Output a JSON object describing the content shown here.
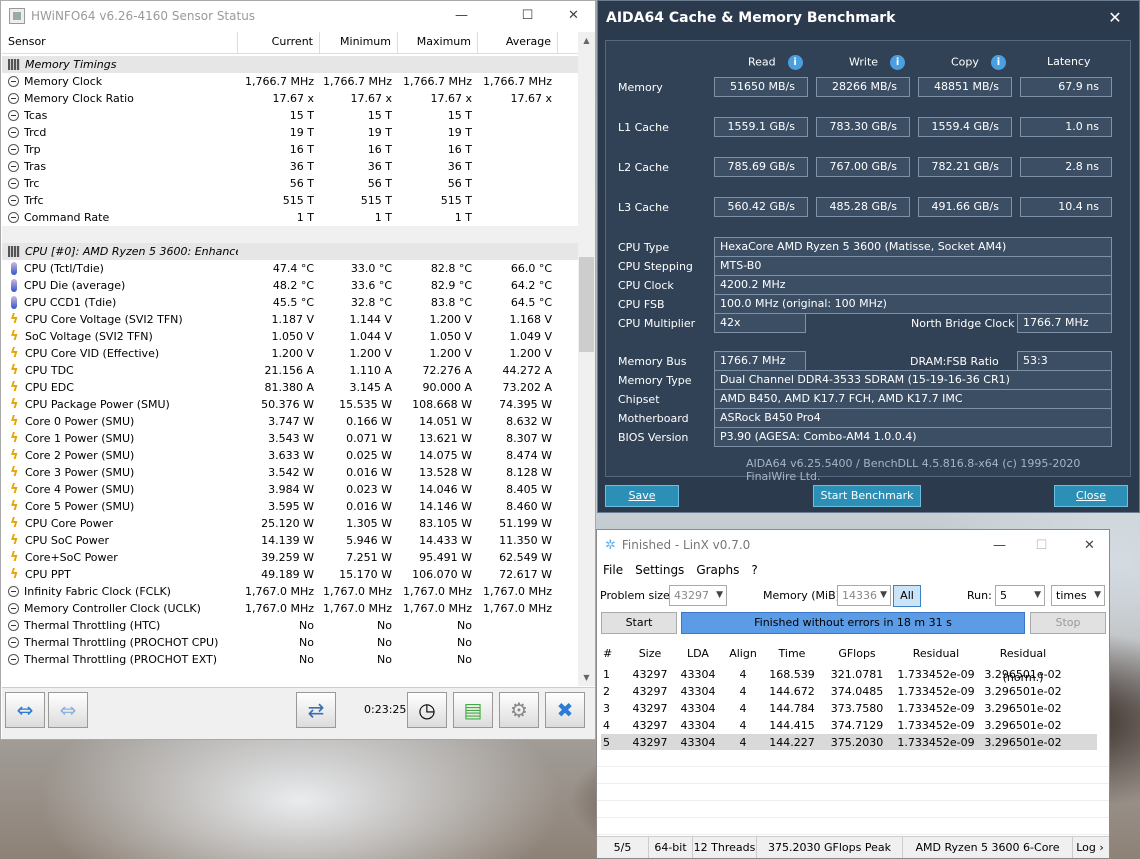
{
  "hwinfo": {
    "title": "HWiNFO64 v6.26-4160 Sensor Status",
    "columns": [
      "Sensor",
      "Current",
      "Minimum",
      "Maximum",
      "Average"
    ],
    "rows": [
      {
        "icon": "group",
        "name": "Memory Timings",
        "cur": "",
        "min": "",
        "max": "",
        "avg": ""
      },
      {
        "icon": "gauge",
        "name": "Memory Clock",
        "cur": "1,766.7 MHz",
        "min": "1,766.7 MHz",
        "max": "1,766.7 MHz",
        "avg": "1,766.7 MHz"
      },
      {
        "icon": "gauge",
        "name": "Memory Clock Ratio",
        "cur": "17.67 x",
        "min": "17.67 x",
        "max": "17.67 x",
        "avg": "17.67 x"
      },
      {
        "icon": "gauge",
        "name": "Tcas",
        "cur": "15 T",
        "min": "15 T",
        "max": "15 T",
        "avg": ""
      },
      {
        "icon": "gauge",
        "name": "Trcd",
        "cur": "19 T",
        "min": "19 T",
        "max": "19 T",
        "avg": ""
      },
      {
        "icon": "gauge",
        "name": "Trp",
        "cur": "16 T",
        "min": "16 T",
        "max": "16 T",
        "avg": ""
      },
      {
        "icon": "gauge",
        "name": "Tras",
        "cur": "36 T",
        "min": "36 T",
        "max": "36 T",
        "avg": ""
      },
      {
        "icon": "gauge",
        "name": "Trc",
        "cur": "56 T",
        "min": "56 T",
        "max": "56 T",
        "avg": ""
      },
      {
        "icon": "gauge",
        "name": "Trfc",
        "cur": "515 T",
        "min": "515 T",
        "max": "515 T",
        "avg": ""
      },
      {
        "icon": "gauge",
        "name": "Command Rate",
        "cur": "1 T",
        "min": "1 T",
        "max": "1 T",
        "avg": ""
      },
      {
        "icon": "blank",
        "name": "",
        "cur": "",
        "min": "",
        "max": "",
        "avg": ""
      },
      {
        "icon": "group",
        "name": "CPU [#0]: AMD Ryzen 5 3600: Enhanced",
        "cur": "",
        "min": "",
        "max": "",
        "avg": ""
      },
      {
        "icon": "temp",
        "name": "CPU (Tctl/Tdie)",
        "cur": "47.4 °C",
        "min": "33.0 °C",
        "max": "82.8 °C",
        "avg": "66.0 °C"
      },
      {
        "icon": "temp",
        "name": "CPU Die (average)",
        "cur": "48.2 °C",
        "min": "33.6 °C",
        "max": "82.9 °C",
        "avg": "64.2 °C"
      },
      {
        "icon": "temp",
        "name": "CPU CCD1 (Tdie)",
        "cur": "45.5 °C",
        "min": "32.8 °C",
        "max": "83.8 °C",
        "avg": "64.5 °C"
      },
      {
        "icon": "bolt",
        "name": "CPU Core Voltage (SVI2 TFN)",
        "cur": "1.187 V",
        "min": "1.144 V",
        "max": "1.200 V",
        "avg": "1.168 V"
      },
      {
        "icon": "bolt",
        "name": "SoC Voltage (SVI2 TFN)",
        "cur": "1.050 V",
        "min": "1.044 V",
        "max": "1.050 V",
        "avg": "1.049 V"
      },
      {
        "icon": "bolt",
        "name": "CPU Core VID (Effective)",
        "cur": "1.200 V",
        "min": "1.200 V",
        "max": "1.200 V",
        "avg": "1.200 V"
      },
      {
        "icon": "bolt",
        "name": "CPU TDC",
        "cur": "21.156 A",
        "min": "1.110 A",
        "max": "72.276 A",
        "avg": "44.272 A"
      },
      {
        "icon": "bolt",
        "name": "CPU EDC",
        "cur": "81.380 A",
        "min": "3.145 A",
        "max": "90.000 A",
        "avg": "73.202 A"
      },
      {
        "icon": "bolt",
        "name": "CPU Package Power (SMU)",
        "cur": "50.376 W",
        "min": "15.535 W",
        "max": "108.668 W",
        "avg": "74.395 W"
      },
      {
        "icon": "bolt",
        "name": "Core 0 Power (SMU)",
        "cur": "3.747 W",
        "min": "0.166 W",
        "max": "14.051 W",
        "avg": "8.632 W"
      },
      {
        "icon": "bolt",
        "name": "Core 1 Power (SMU)",
        "cur": "3.543 W",
        "min": "0.071 W",
        "max": "13.621 W",
        "avg": "8.307 W"
      },
      {
        "icon": "bolt",
        "name": "Core 2 Power (SMU)",
        "cur": "3.633 W",
        "min": "0.025 W",
        "max": "14.075 W",
        "avg": "8.474 W"
      },
      {
        "icon": "bolt",
        "name": "Core 3 Power (SMU)",
        "cur": "3.542 W",
        "min": "0.016 W",
        "max": "13.528 W",
        "avg": "8.128 W"
      },
      {
        "icon": "bolt",
        "name": "Core 4 Power (SMU)",
        "cur": "3.984 W",
        "min": "0.023 W",
        "max": "14.046 W",
        "avg": "8.405 W"
      },
      {
        "icon": "bolt",
        "name": "Core 5 Power (SMU)",
        "cur": "3.595 W",
        "min": "0.016 W",
        "max": "14.146 W",
        "avg": "8.460 W"
      },
      {
        "icon": "bolt",
        "name": "CPU Core Power",
        "cur": "25.120 W",
        "min": "1.305 W",
        "max": "83.105 W",
        "avg": "51.199 W"
      },
      {
        "icon": "bolt",
        "name": "CPU SoC Power",
        "cur": "14.139 W",
        "min": "5.946 W",
        "max": "14.433 W",
        "avg": "11.350 W"
      },
      {
        "icon": "bolt",
        "name": "Core+SoC Power",
        "cur": "39.259 W",
        "min": "7.251 W",
        "max": "95.491 W",
        "avg": "62.549 W"
      },
      {
        "icon": "bolt",
        "name": "CPU PPT",
        "cur": "49.189 W",
        "min": "15.170 W",
        "max": "106.070 W",
        "avg": "72.617 W"
      },
      {
        "icon": "gauge",
        "name": "Infinity Fabric Clock (FCLK)",
        "cur": "1,767.0 MHz",
        "min": "1,767.0 MHz",
        "max": "1,767.0 MHz",
        "avg": "1,767.0 MHz"
      },
      {
        "icon": "gauge",
        "name": "Memory Controller Clock (UCLK)",
        "cur": "1,767.0 MHz",
        "min": "1,767.0 MHz",
        "max": "1,767.0 MHz",
        "avg": "1,767.0 MHz"
      },
      {
        "icon": "gauge",
        "name": "Thermal Throttling (HTC)",
        "cur": "No",
        "min": "No",
        "max": "No",
        "avg": ""
      },
      {
        "icon": "gauge",
        "name": "Thermal Throttling (PROCHOT CPU)",
        "cur": "No",
        "min": "No",
        "max": "No",
        "avg": ""
      },
      {
        "icon": "gauge",
        "name": "Thermal Throttling (PROCHOT EXT)",
        "cur": "No",
        "min": "No",
        "max": "No",
        "avg": ""
      }
    ],
    "timer": "0:23:25"
  },
  "aida": {
    "title": "AIDA64 Cache & Memory Benchmark",
    "cols": [
      "Read",
      "Write",
      "Copy",
      "Latency"
    ],
    "bench": [
      {
        "label": "Memory",
        "read": "51650 MB/s",
        "write": "28266 MB/s",
        "copy": "48851 MB/s",
        "lat": "67.9 ns"
      },
      {
        "label": "L1 Cache",
        "read": "1559.1 GB/s",
        "write": "783.30 GB/s",
        "copy": "1559.4 GB/s",
        "lat": "1.0 ns"
      },
      {
        "label": "L2 Cache",
        "read": "785.69 GB/s",
        "write": "767.00 GB/s",
        "copy": "782.21 GB/s",
        "lat": "2.8 ns"
      },
      {
        "label": "L3 Cache",
        "read": "560.42 GB/s",
        "write": "485.28 GB/s",
        "copy": "491.66 GB/s",
        "lat": "10.4 ns"
      }
    ],
    "cpu_type_label": "CPU Type",
    "cpu_type": "HexaCore AMD Ryzen 5 3600  (Matisse, Socket AM4)",
    "cpu_step_label": "CPU Stepping",
    "cpu_step": "MTS-B0",
    "cpu_clock_label": "CPU Clock",
    "cpu_clock": "4200.2 MHz",
    "cpu_fsb_label": "CPU FSB",
    "cpu_fsb": "100.0 MHz  (original: 100 MHz)",
    "cpu_mult_label": "CPU Multiplier",
    "cpu_mult": "42x",
    "nb_label": "North Bridge Clock",
    "nb": "1766.7 MHz",
    "mem_bus_label": "Memory Bus",
    "mem_bus": "1766.7 MHz",
    "dram_label": "DRAM:FSB Ratio",
    "dram": "53:3",
    "mem_type_label": "Memory Type",
    "mem_type": "Dual Channel DDR4-3533 SDRAM  (15-19-16-36 CR1)",
    "chipset_label": "Chipset",
    "chipset": "AMD B450, AMD K17.7 FCH, AMD K17.7 IMC",
    "mobo_label": "Motherboard",
    "mobo": "ASRock B450 Pro4",
    "bios_label": "BIOS Version",
    "bios": "P3.90  (AGESA: Combo-AM4 1.0.0.4)",
    "footer": "AIDA64 v6.25.5400 / BenchDLL 4.5.816.8-x64  (c) 1995-2020 FinalWire Ltd.",
    "save": "Save",
    "start": "Start Benchmark",
    "close": "Close"
  },
  "linx": {
    "title": "Finished - LinX v0.7.0",
    "menu": [
      "File",
      "Settings",
      "Graphs",
      "?"
    ],
    "problem_label": "Problem size:",
    "problem": "43297",
    "memory_label": "Memory (MiB):",
    "memory": "14336",
    "all": "All",
    "run_label": "Run:",
    "run": "5",
    "times": "times",
    "start": "Start",
    "progress": "Finished without errors in 18 m 31 s",
    "stop": "Stop",
    "headers": [
      "#",
      "Size",
      "LDA",
      "Align",
      "Time",
      "GFlops",
      "Residual",
      "Residual (norm.)"
    ],
    "rows": [
      [
        "1",
        "43297",
        "43304",
        "4",
        "168.539",
        "321.0781",
        "1.733452e-09",
        "3.296501e-02"
      ],
      [
        "2",
        "43297",
        "43304",
        "4",
        "144.672",
        "374.0485",
        "1.733452e-09",
        "3.296501e-02"
      ],
      [
        "3",
        "43297",
        "43304",
        "4",
        "144.784",
        "373.7580",
        "1.733452e-09",
        "3.296501e-02"
      ],
      [
        "4",
        "43297",
        "43304",
        "4",
        "144.415",
        "374.7129",
        "1.733452e-09",
        "3.296501e-02"
      ],
      [
        "5",
        "43297",
        "43304",
        "4",
        "144.227",
        "375.2030",
        "1.733452e-09",
        "3.296501e-02"
      ]
    ],
    "status": [
      "5/5",
      "64-bit",
      "12 Threads",
      "375.2030 GFlops Peak",
      "AMD Ryzen 5 3600 6-Core",
      "Log ›"
    ]
  }
}
